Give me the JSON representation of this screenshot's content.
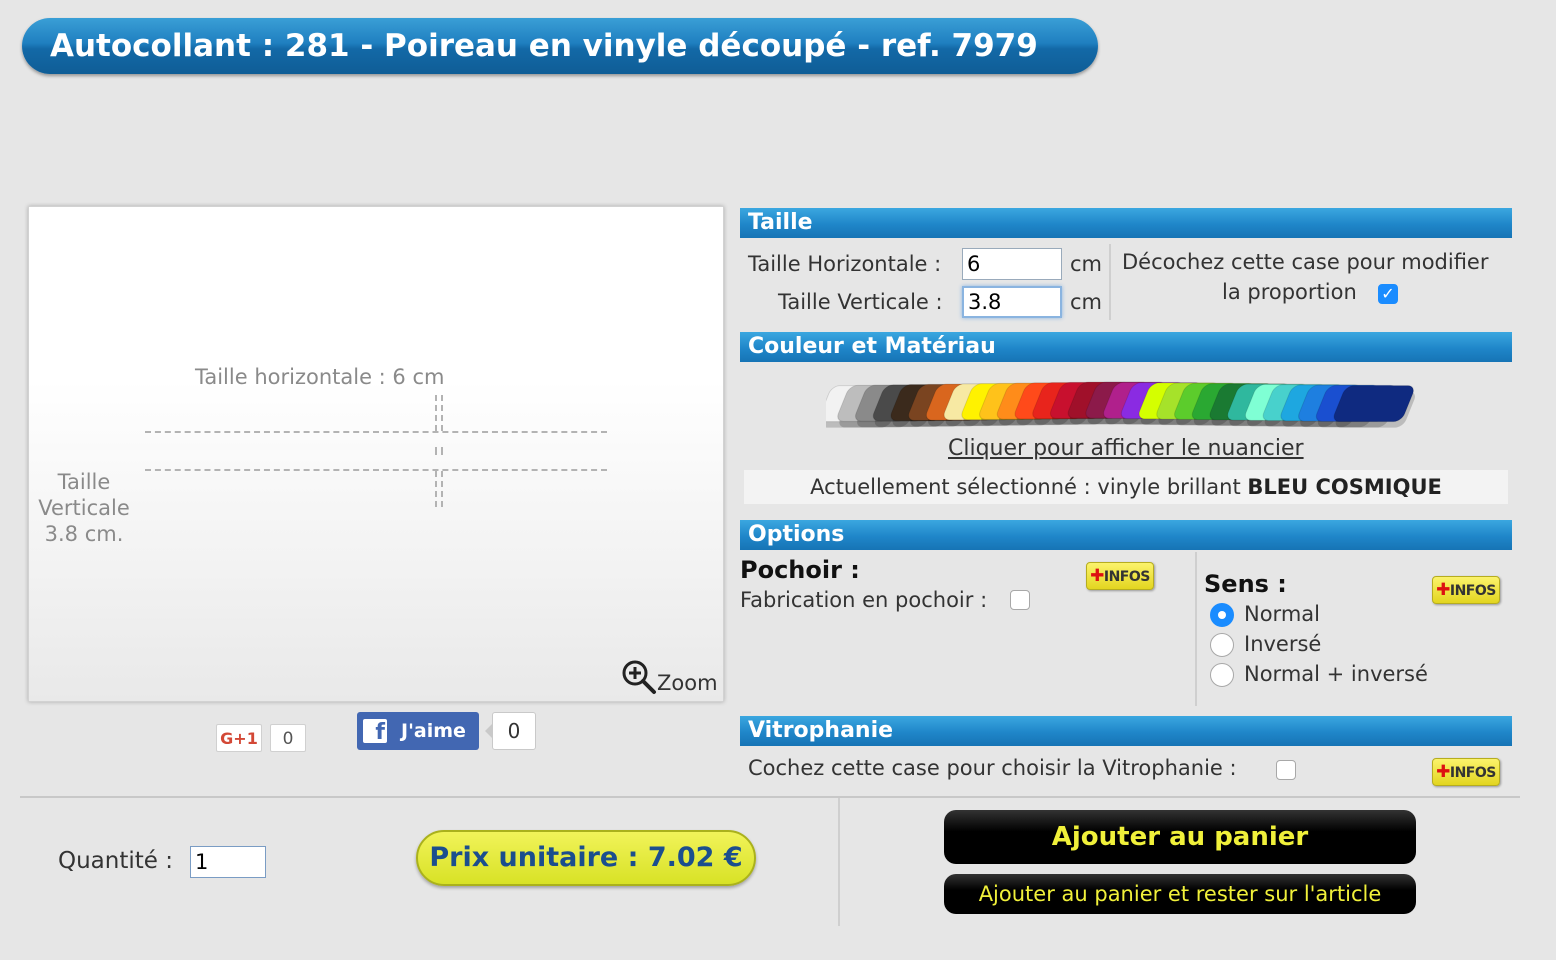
{
  "header": {
    "title": "Autocollant : 281 - Poireau en vinyle découpé - ref. 7979"
  },
  "preview": {
    "horizontal_label": "Taille horizontale : 6 cm",
    "vertical_label_lines": [
      "Taille",
      "Verticale",
      "3.8 cm."
    ],
    "zoom_label": "Zoom"
  },
  "social": {
    "gplus_label": "G+1",
    "gplus_count": "0",
    "fb_label": "J'aime",
    "fb_count": "0"
  },
  "taille": {
    "heading": "Taille",
    "horizontal_label": "Taille Horizontale :",
    "horizontal_value": "6",
    "vertical_label": "Taille Verticale :",
    "vertical_value": "3.8",
    "unit": "cm",
    "proportion_line1": "Décochez cette case pour modifier",
    "proportion_line2": "la proportion",
    "proportion_checked": true
  },
  "couleur": {
    "heading": "Couleur et Matériau",
    "nuancier_link": "Cliquer pour afficher le nuancier",
    "selected_prefix": "Actuellement sélectionné : vinyle brillant",
    "selected_color": "BLEU COSMIQUE",
    "swatch_colors": [
      "#f2f2f2",
      "#bdbdbd",
      "#8a8a8a",
      "#4a4a4a",
      "#3b2a1c",
      "#7a4420",
      "#d9661e",
      "#f7e9a3",
      "#fff200",
      "#ffc21a",
      "#ff8c1a",
      "#ff4a1a",
      "#e8241c",
      "#c8102e",
      "#a0102a",
      "#8c1a4a",
      "#b0208c",
      "#8a2be2",
      "#d4ff00",
      "#a6e22a",
      "#5ccc2c",
      "#2aa832",
      "#1a7a32",
      "#2fb89e",
      "#7fffd4",
      "#48d1cc",
      "#1ea7e0",
      "#1e7fe0",
      "#1a4fd0",
      "#0f2a80"
    ]
  },
  "options": {
    "heading": "Options",
    "pochoir_title": "Pochoir :",
    "pochoir_label": "Fabrication en pochoir :",
    "infos_label": "INFOS",
    "sens_title": "Sens :",
    "sens_options": [
      "Normal",
      "Inversé",
      "Normal + inversé"
    ],
    "sens_selected": "Normal"
  },
  "vitrophanie": {
    "heading": "Vitrophanie",
    "label": "Cochez cette case pour choisir la Vitrophanie :"
  },
  "footer": {
    "quantity_label": "Quantité :",
    "quantity_value": "1",
    "price_label": "Prix unitaire : 7.02 €",
    "cart_button": "Ajouter au panier",
    "cart_stay_button": "Ajouter au panier et rester sur l'article"
  },
  "colors": {
    "accent_blue": "#1f86c9",
    "price_yellow": "#e4eb3a",
    "cart_text": "#f0f03a",
    "price_text": "#1b4e8e"
  }
}
